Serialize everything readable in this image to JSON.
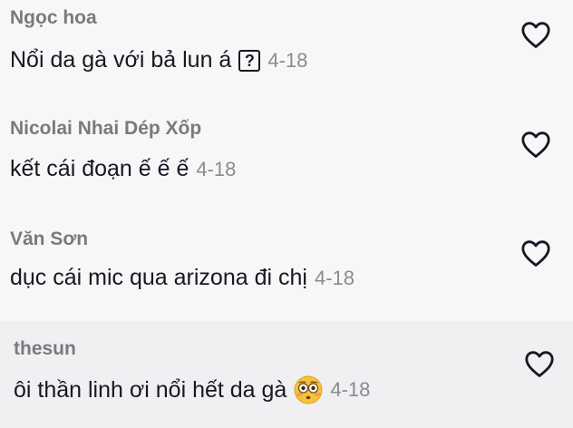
{
  "comments": [
    {
      "username": "Ngọc hoa",
      "text": "Nổi da gà với bả lun á",
      "date": "4-18",
      "icon": "question-box-icon"
    },
    {
      "username": "Nicolai Nhai Dép Xốp",
      "text": "kết cái đoạn ế ế ế",
      "date": "4-18"
    },
    {
      "username": "Văn Sơn",
      "text": "dục cái mic qua arizona đi chị",
      "date": "4-18"
    },
    {
      "username": "thesun",
      "text": "ôi thần linh ơi nổi hết da gà",
      "date": "4-18",
      "icon": "flushed-face-emoji-icon"
    }
  ],
  "qbox_symbol": "?",
  "colors": {
    "background": "#f7f7f8",
    "highlight_background": "#f0eff1",
    "username": "#7a7a7e",
    "text": "#161823",
    "date": "#8a8b91"
  }
}
